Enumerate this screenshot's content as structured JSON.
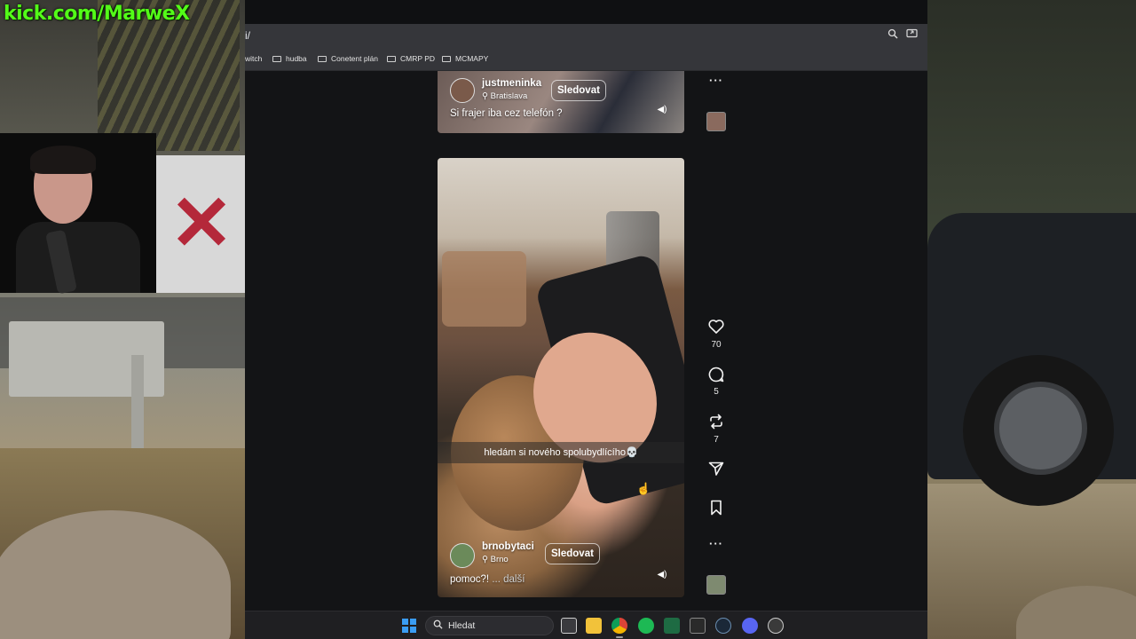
{
  "overlay": {
    "stream_url": "kick.com/MarweX"
  },
  "browser": {
    "url": "i/",
    "icons": {
      "zoom": "zoom-icon",
      "cast": "cast-icon"
    },
    "bookmarks": [
      {
        "label": "witch",
        "folder": false
      },
      {
        "label": "hudba",
        "folder": true
      },
      {
        "label": "Conetent plán",
        "folder": true
      },
      {
        "label": "CMRP PD",
        "folder": true
      },
      {
        "label": "MCMAPY",
        "folder": true
      }
    ]
  },
  "feed": {
    "posts": [
      {
        "username": "justmeninka",
        "location": "Bratislava",
        "follow_label": "Sledovat",
        "caption": "Si frajer iba cez telefón ?"
      },
      {
        "username": "brnobytaci",
        "location": "Brno",
        "follow_label": "Sledovat",
        "subtitle": "hledám si nového spolubydlícího💀",
        "caption": "pomoc?!",
        "more_label": "... další"
      }
    ],
    "actions": {
      "likes": "70",
      "comments": "5",
      "reposts": "7"
    }
  },
  "taskbar": {
    "search_placeholder": "Hledat",
    "apps": [
      "task-view",
      "file-explorer",
      "chrome",
      "spotify",
      "excel",
      "epic-games",
      "steam",
      "discord",
      "app"
    ]
  },
  "colors": {
    "kick_green": "#53fc18",
    "windows_blue": "#3a9df4"
  }
}
